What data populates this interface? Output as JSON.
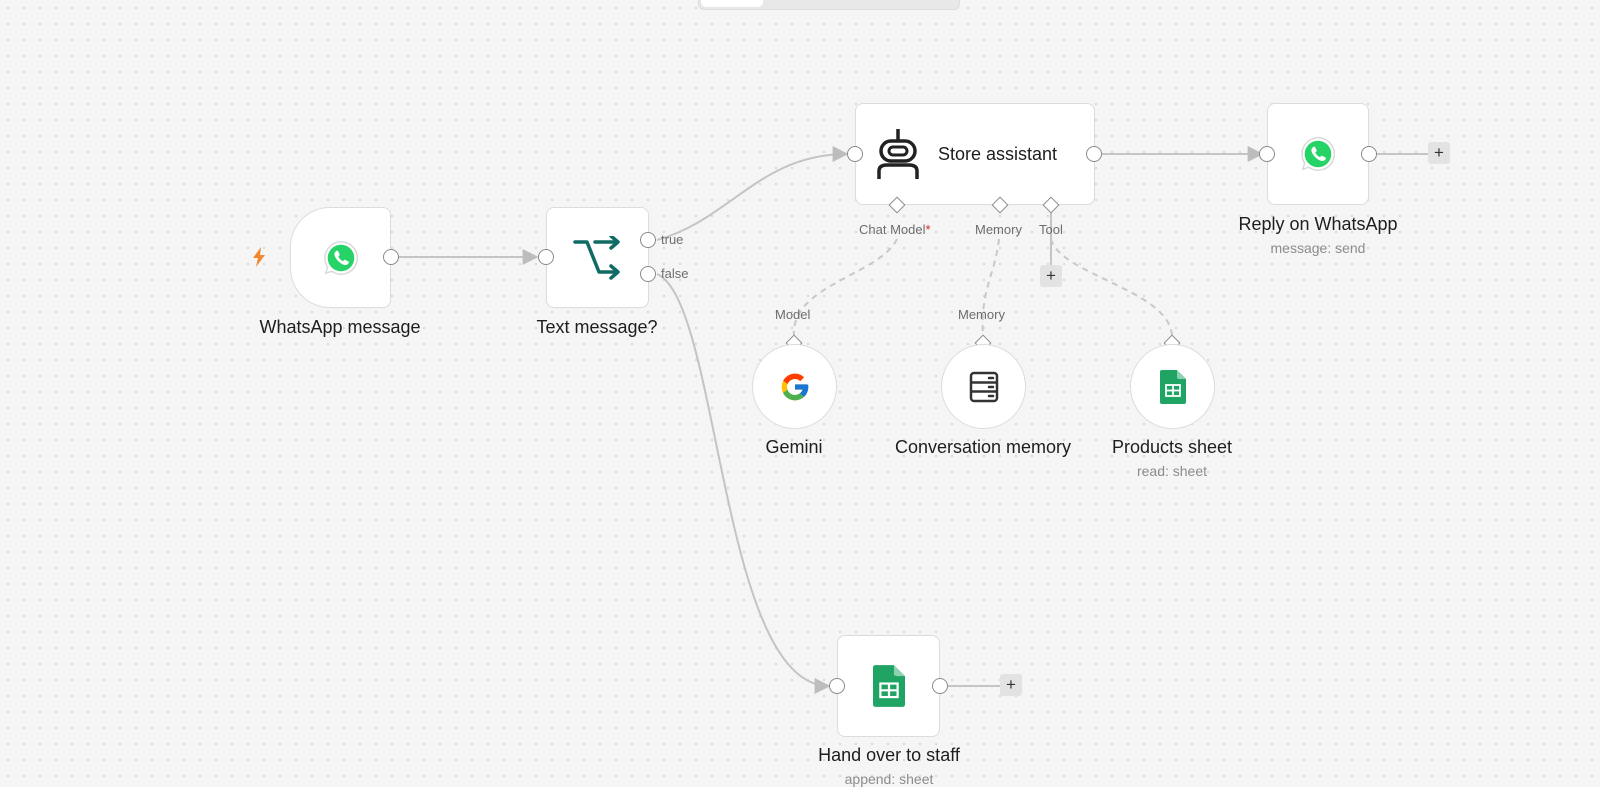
{
  "nodes": {
    "whatsapp_trigger": {
      "name": "WhatsApp message"
    },
    "if_node": {
      "name": "Text message?",
      "outputs": {
        "true": "true",
        "false": "false"
      }
    },
    "agent": {
      "name": "Store assistant",
      "inputs": {
        "chat_model": "Chat Model",
        "chat_model_required": "*",
        "memory": "Memory",
        "tool": "Tool"
      }
    },
    "reply": {
      "name": "Reply on WhatsApp",
      "subtitle": "message: send"
    },
    "gemini": {
      "name": "Gemini",
      "port": "Model"
    },
    "memory": {
      "name": "Conversation memory",
      "port": "Memory"
    },
    "products": {
      "name": "Products sheet",
      "subtitle": "read: sheet"
    },
    "handover": {
      "name": "Hand over to staff",
      "subtitle": "append: sheet"
    }
  },
  "add_button_label": "+",
  "colors": {
    "whatsapp": "#25D366",
    "sheets": "#1FA463",
    "if_icon": "#0f6b63",
    "trigger_bolt": "#f0892e"
  },
  "icons": {
    "trigger": "lightning-bolt-icon",
    "whatsapp": "whatsapp-icon",
    "if": "branch-arrows-icon",
    "agent": "robot-icon",
    "gemini": "google-icon",
    "memory": "database-icon",
    "sheets": "google-sheets-icon"
  }
}
